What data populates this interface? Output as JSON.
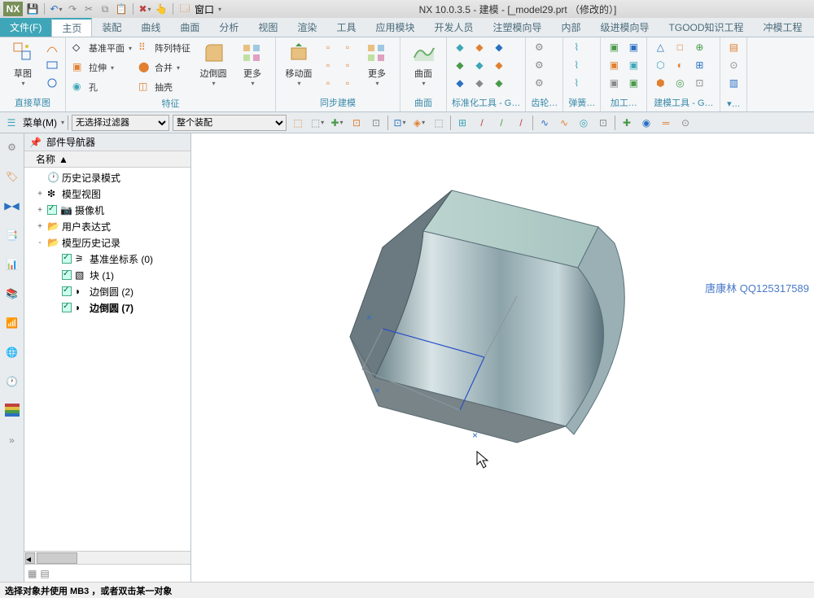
{
  "title": "NX 10.0.3.5 - 建模 - [_model29.prt （修改的）]",
  "nx_logo": "NX",
  "qat": {
    "window_label": "窗口"
  },
  "menu": {
    "file": "文件(F)",
    "tabs": [
      "主页",
      "装配",
      "曲线",
      "曲面",
      "分析",
      "视图",
      "渲染",
      "工具",
      "应用模块",
      "开发人员",
      "注塑模向导",
      "内部",
      "级进模向导",
      "TGOOD知识工程",
      "冲模工程"
    ],
    "active_index": 0
  },
  "ribbon": {
    "groups": [
      {
        "label": "直接草图",
        "big": [
          {
            "lbl": "草图",
            "ico": "sketch"
          }
        ],
        "cells": [
          [
            "sk1"
          ],
          [
            "sk2"
          ],
          [
            "sk3"
          ]
        ]
      },
      {
        "label": "特征",
        "big": [
          {
            "lbl": "边倒圆",
            "ico": "fillet"
          },
          {
            "lbl": "更多",
            "ico": "more"
          }
        ],
        "rows": [
          {
            "ico": "datum",
            "lbl": "基准平面"
          },
          {
            "ico": "extrude",
            "lbl": "拉伸"
          },
          {
            "ico": "hole",
            "lbl": "孔"
          }
        ],
        "rows2": [
          {
            "ico": "pattern",
            "lbl": "阵列特征"
          },
          {
            "ico": "unite",
            "lbl": "合并"
          },
          {
            "ico": "shell",
            "lbl": "抽壳"
          }
        ]
      },
      {
        "label": "同步建模",
        "big": [
          {
            "lbl": "移动面",
            "ico": "moveface"
          },
          {
            "lbl": "更多",
            "ico": "more"
          }
        ],
        "cells": [
          [
            "s1",
            "s2"
          ],
          [
            "s3",
            "s4"
          ],
          [
            "s5",
            "s6"
          ]
        ]
      },
      {
        "label": "曲面",
        "big": [
          {
            "lbl": "曲面",
            "ico": "surface"
          }
        ]
      },
      {
        "label": "标准化工具 - G…",
        "cells": [
          [
            "a1",
            "a2",
            "a3"
          ],
          [
            "a4",
            "a5",
            "a6"
          ],
          [
            "a7",
            "a8",
            "a9"
          ]
        ]
      },
      {
        "label": "齿轮…",
        "cells": [
          [
            "g1"
          ],
          [
            "g2"
          ],
          [
            "g3"
          ]
        ]
      },
      {
        "label": "弹簧…",
        "cells": [
          [
            "p1"
          ],
          [
            "p2"
          ],
          [
            "p3"
          ]
        ]
      },
      {
        "label": "加工…",
        "cells": [
          [
            "m1",
            "m2"
          ],
          [
            "m3",
            "m4"
          ],
          [
            "m5",
            "m6"
          ]
        ]
      },
      {
        "label": "建模工具 - G…",
        "cells": [
          [
            "t1",
            "t2",
            "t3"
          ],
          [
            "t4",
            "t5",
            "t6"
          ],
          [
            "t7",
            "t8",
            "t9"
          ]
        ]
      },
      {
        "label": "▾…",
        "cells": [
          [
            "x1"
          ],
          [
            "x2"
          ],
          [
            "x3"
          ]
        ]
      }
    ]
  },
  "selbar": {
    "menu_btn": "菜单(M)",
    "filter1": "无选择过滤器",
    "filter2": "整个装配"
  },
  "nav": {
    "title": "部件导航器",
    "col": "名称",
    "items": [
      {
        "exp": "",
        "ico": "clock",
        "chk": false,
        "lbl": "历史记录模式",
        "lvl": 1
      },
      {
        "exp": "+",
        "ico": "cube-g",
        "chk": false,
        "lbl": "模型视图",
        "lvl": 1
      },
      {
        "exp": "+",
        "ico": "cam",
        "chk": true,
        "lbl": "摄像机",
        "lvl": 1
      },
      {
        "exp": "+",
        "ico": "folder",
        "chk": false,
        "lbl": "用户表达式",
        "lvl": 1
      },
      {
        "exp": "-",
        "ico": "folder",
        "chk": false,
        "lbl": "模型历史记录",
        "lvl": 1
      },
      {
        "exp": "",
        "ico": "csys",
        "chk": true,
        "lbl": "基准坐标系 (0)",
        "lvl": 2
      },
      {
        "exp": "",
        "ico": "block",
        "chk": true,
        "lbl": "块 (1)",
        "lvl": 2
      },
      {
        "exp": "",
        "ico": "fillet",
        "chk": true,
        "lbl": "边倒圆 (2)",
        "lvl": 2
      },
      {
        "exp": "",
        "ico": "fillet",
        "chk": true,
        "lbl": "边倒圆 (7)",
        "lvl": 2,
        "bold": true
      }
    ]
  },
  "watermark": "唐康林 QQ125317589",
  "status": "选择对象并使用 MB3 ，或者双击某一对象"
}
